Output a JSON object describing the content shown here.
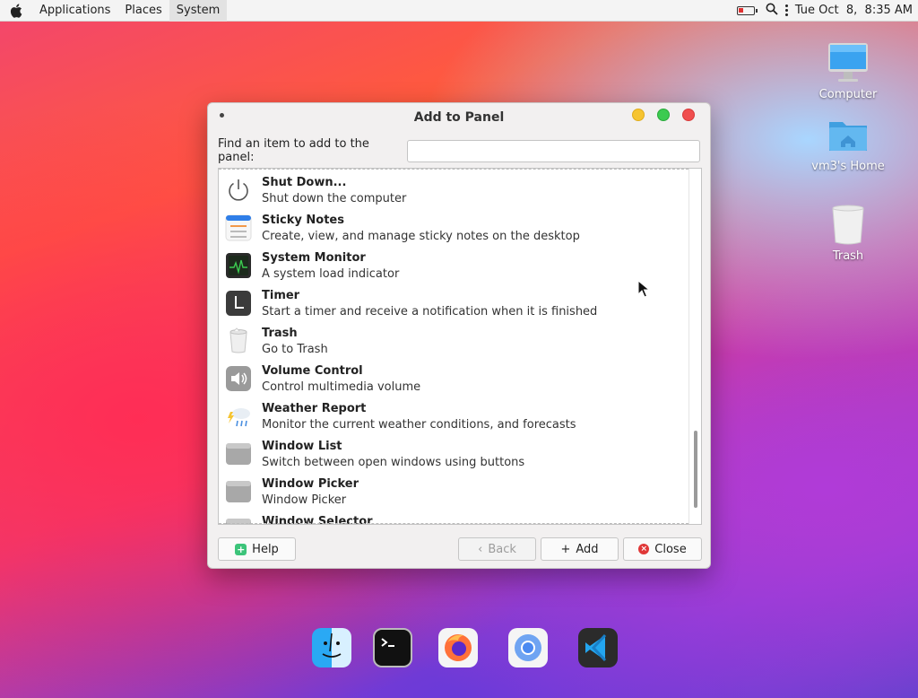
{
  "topbar": {
    "menus": [
      "Applications",
      "Places",
      "System"
    ],
    "clock": "Tue Oct  8,  8:35 AM"
  },
  "desktop": {
    "icons": [
      {
        "label": "Computer"
      },
      {
        "label": "vm3's Home"
      },
      {
        "label": "Trash"
      }
    ]
  },
  "dialog": {
    "title": "Add to Panel",
    "find_label": "Find an item to add to the panel:",
    "find_value": "",
    "items": [
      {
        "name": "Shut Down...",
        "desc": "Shut down the computer",
        "icon": "power-icon"
      },
      {
        "name": "Sticky Notes",
        "desc": "Create, view, and manage sticky notes on the desktop",
        "icon": "sticky-notes-icon"
      },
      {
        "name": "System Monitor",
        "desc": "A system load indicator",
        "icon": "system-monitor-icon"
      },
      {
        "name": "Timer",
        "desc": "Start a timer and receive a notification when it is finished",
        "icon": "timer-icon"
      },
      {
        "name": "Trash",
        "desc": "Go to Trash",
        "icon": "trash-icon"
      },
      {
        "name": "Volume Control",
        "desc": "Control multimedia volume",
        "icon": "volume-icon"
      },
      {
        "name": "Weather Report",
        "desc": "Monitor the current weather conditions, and forecasts",
        "icon": "weather-icon"
      },
      {
        "name": "Window List",
        "desc": "Switch between open windows using buttons",
        "icon": "window-list-icon"
      },
      {
        "name": "Window Picker",
        "desc": "Window Picker",
        "icon": "window-picker-icon"
      },
      {
        "name": "Window Selector",
        "desc": "",
        "icon": "window-selector-icon"
      }
    ],
    "buttons": {
      "help": "Help",
      "back": "Back",
      "add": "Add",
      "close": "Close"
    }
  },
  "dock": {
    "apps": [
      "finder-icon",
      "terminal-icon",
      "firefox-icon",
      "chromium-icon",
      "vscode-icon"
    ]
  },
  "colors": {
    "accent_green": "#3cc47a",
    "close_red": "#e03838"
  }
}
